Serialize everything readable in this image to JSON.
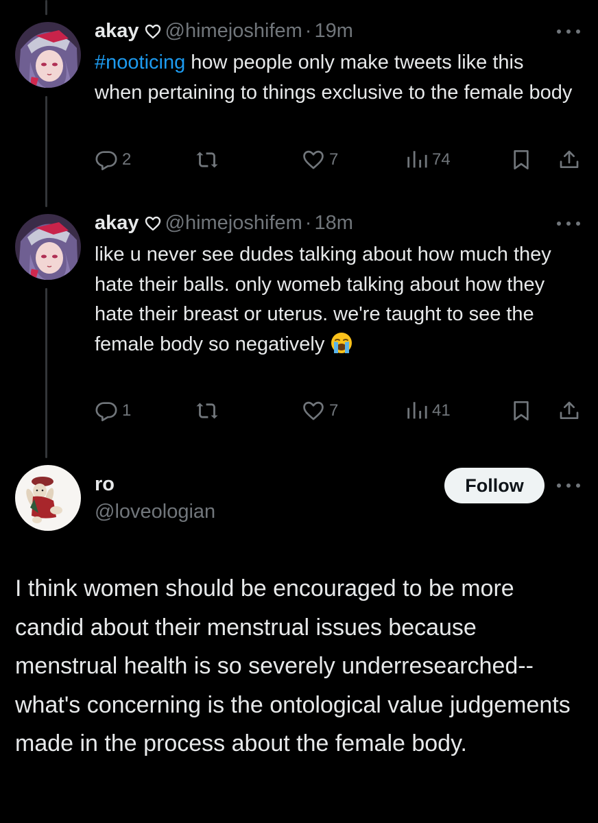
{
  "thread": [
    {
      "author": "akay",
      "handle": "@himejoshifem",
      "separator": "·",
      "time": "19m",
      "hashtag": "#nooticing",
      "text": "how people only make tweets like this when pertaining to things exclusive to the female body",
      "replies": "2",
      "likes": "7",
      "views": "74"
    },
    {
      "author": "akay",
      "handle": "@himejoshifem",
      "separator": "·",
      "time": "18m",
      "text": "like u never see dudes talking about how much they hate their balls. only womeb talking about how they hate their breast or uterus. we're taught to see the female body so negatively",
      "emoji_name": "loudly-crying-face",
      "replies": "1",
      "likes": "7",
      "views": "41"
    }
  ],
  "main_tweet": {
    "author": "ro",
    "handle": "@loveologian",
    "follow_label": "Follow",
    "text": "I think women should be encouraged to be more candid about their menstrual issues because menstrual health is so severely underresearched-- what's concerning is the ontological value judgements made in the process about the female body."
  },
  "colors": {
    "background": "#000000",
    "text": "#e7e9ea",
    "secondary": "#71767b",
    "accent": "#1d9bf0",
    "thread_line": "#333639",
    "follow_bg": "#eff3f4"
  },
  "icons": [
    "verified-heart-icon",
    "reply-icon",
    "retweet-icon",
    "like-icon",
    "views-icon",
    "bookmark-icon",
    "share-icon",
    "more-icon"
  ]
}
